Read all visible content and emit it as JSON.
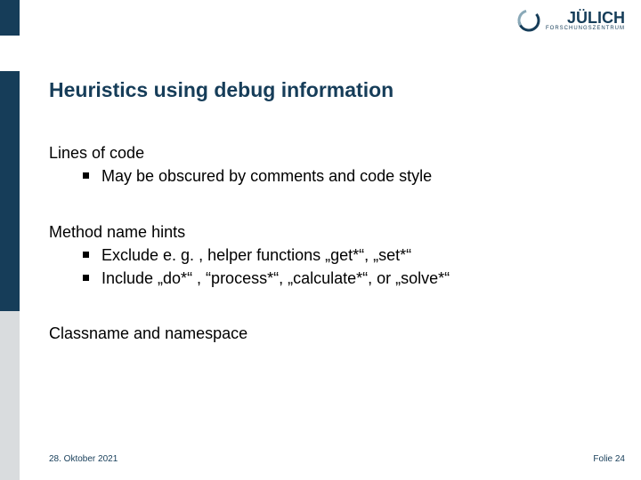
{
  "logo": {
    "name": "JÜLICH",
    "subtitle": "FORSCHUNGSZENTRUM"
  },
  "title": "Heuristics using debug information",
  "sections": [
    {
      "heading": "Lines of code",
      "bullets": [
        "May be obscured by comments and code style"
      ]
    },
    {
      "heading": "Method name hints",
      "bullets": [
        "Exclude e. g. , helper functions „get*“, „set*“",
        "Include „do*“ , “process*“, „calculate*“, or „solve*“"
      ]
    },
    {
      "heading": "Classname and namespace",
      "bullets": []
    }
  ],
  "footer": {
    "date": "28. Oktober 2021",
    "page": "Folie 24"
  }
}
